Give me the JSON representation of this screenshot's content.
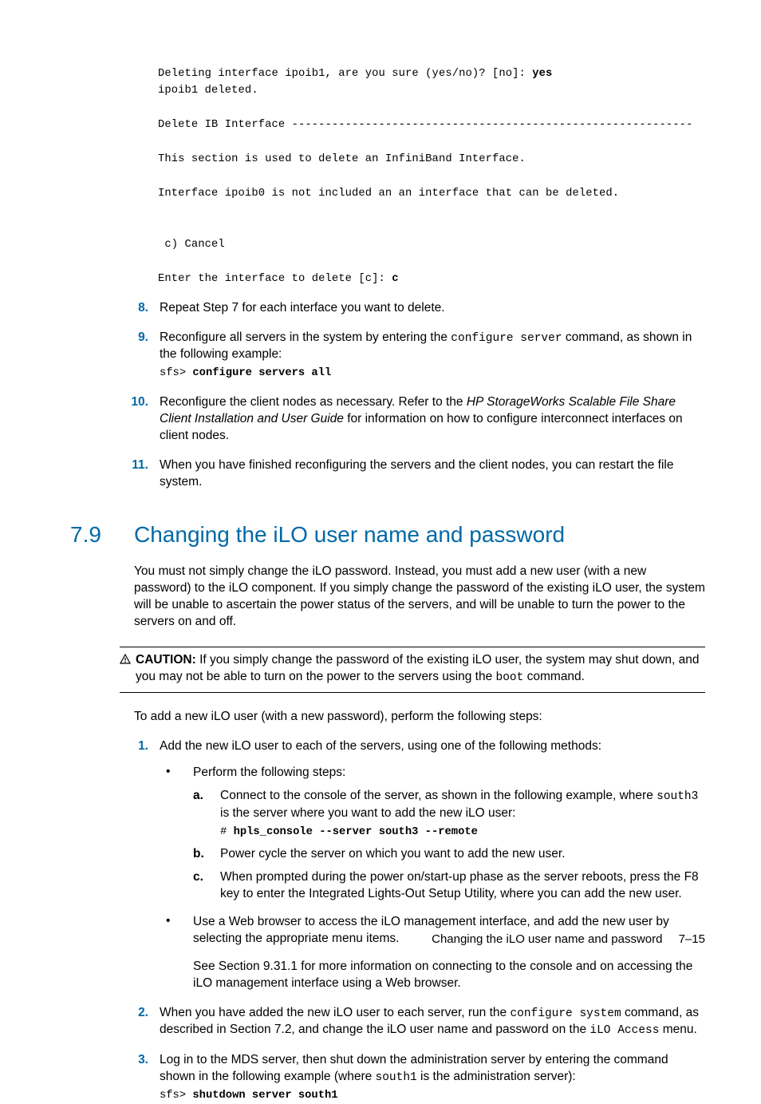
{
  "code1": {
    "l1a": "Deleting interface ipoib1, are you sure (yes/no)? [no]: ",
    "l1b": "yes",
    "l2": "ipoib1 deleted.",
    "l3": "Delete IB Interface ------------------------------------------------------------",
    "l4": "This section is used to delete an InfiniBand Interface.",
    "l5": "Interface ipoib0 is not included an an interface that can be deleted.",
    "l6": " c) Cancel",
    "l7a": "Enter the interface to delete [c]: ",
    "l7b": "c"
  },
  "list1": {
    "s8": {
      "num": "8.",
      "text": "Repeat Step 7 for each interface you want to delete."
    },
    "s9": {
      "num": "9.",
      "t1": "Reconfigure all servers in the system by entering the ",
      "mono": "configure server",
      "t2": " command, as shown in the following example:",
      "prompt": "sfs> ",
      "cmd": "configure servers all"
    },
    "s10": {
      "num": "10.",
      "t1": "Reconfigure the client nodes as necessary. Refer to the ",
      "em": "HP StorageWorks Scalable File Share Client Installation and User Guide",
      "t2": " for information on how to configure interconnect interfaces on client nodes."
    },
    "s11": {
      "num": "11.",
      "text": "When you have finished reconfiguring the servers and the client nodes, you can restart the file system."
    }
  },
  "section": {
    "num": "7.9",
    "title": "Changing the iLO user name and password"
  },
  "intro": "You must not simply change the iLO password. Instead, you must add a new user (with a new password) to the iLO component. If you simply change the password of the existing iLO user, the system will be unable to ascertain the power status of the servers, and will be unable to turn the power to the servers on and off.",
  "caution": {
    "label": "CAUTION:",
    "t1": "  If you simply change the password of the existing iLO user, the system may shut down, and you may not be able to turn on the power to the servers using the ",
    "mono": "boot",
    "t2": " command."
  },
  "steps_intro": "To add a new iLO user (with a new password), perform the following steps:",
  "list2": {
    "s1": {
      "num": "1.",
      "text": "Add the new iLO user to each of the servers, using one of the following methods:",
      "b1": {
        "lead": "Perform the following steps:",
        "a": {
          "num": "a.",
          "t1": "Connect to the console of the server, as shown in the following example, where ",
          "mono": "south3",
          "t2": " is the server where you want to add the new iLO user:",
          "prompt": "# ",
          "cmd": "hpls_console --server south3 --remote"
        },
        "b": {
          "num": "b.",
          "text": "Power cycle the server on which you want to add the new user."
        },
        "c": {
          "num": "c.",
          "text": "When prompted during the power on/start-up phase as the server reboots, press the F8 key to enter the Integrated Lights-Out Setup Utility, where you can add the new user."
        }
      },
      "b2": {
        "p1": "Use a Web browser to access the iLO management interface, and add the new user by selecting the appropriate menu items.",
        "p2": "See Section 9.31.1 for more information on connecting to the console and on accessing the iLO management interface using a Web browser."
      }
    },
    "s2": {
      "num": "2.",
      "t1": "When you have added the new iLO user to each server, run the ",
      "mono1": "configure system",
      "t2": " command, as described in Section 7.2, and change the iLO user name and password on the ",
      "mono2": "iLO Access",
      "t3": " menu."
    },
    "s3": {
      "num": "3.",
      "t1": "Log in to the MDS server, then shut down the administration server by entering the command shown in the following example (where ",
      "mono": "south1",
      "t2": " is the administration server):",
      "prompt": "sfs> ",
      "cmd": "shutdown server south1"
    }
  },
  "footer": {
    "label": "Changing the iLO user name and password",
    "pnum": "7–15"
  }
}
